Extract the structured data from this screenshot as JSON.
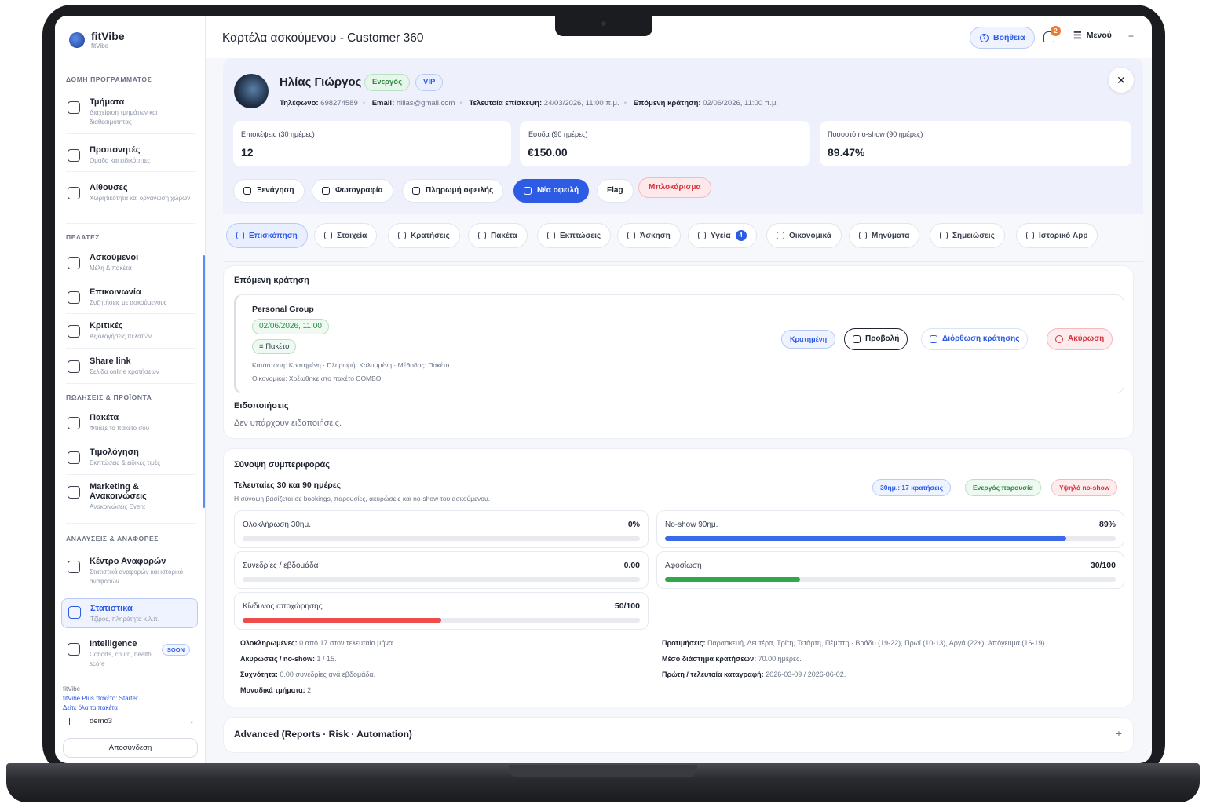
{
  "app": {
    "name": "fitVibe",
    "sub": "fitVibe"
  },
  "sidebar": {
    "sections": [
      {
        "title": "ΔΟΜΗ ΠΡΟΓΡΑΜΜΑΤΟΣ"
      },
      {
        "title": "ΠΕΛΑΤΕΣ"
      },
      {
        "title": "ΠΩΛΗΣΕΙΣ & ΠΡΟΪΟΝΤΑ"
      },
      {
        "title": "ΑΝΑΛΥΣΕΙΣ & ΑΝΑΦΟΡΕΣ"
      }
    ],
    "items": [
      {
        "label": "Τμήματα",
        "sub": "Διαχείριση τμημάτων και διαθεσιμότητας"
      },
      {
        "label": "Προπονητές",
        "sub": "Ομάδα και ειδικότητες"
      },
      {
        "label": "Αίθουσες",
        "sub": "Χωρητικότητα και οργάνωση χώρων"
      },
      {
        "label": "Ασκούμενοι",
        "sub": "Μέλη & πακέτα"
      },
      {
        "label": "Επικοινωνία",
        "sub": "Συζητήσεις με ασκούμενους"
      },
      {
        "label": "Κριτικές",
        "sub": "Αξιολογήσεις πελατών"
      },
      {
        "label": "Share link",
        "sub": "Σελίδα online κρατήσεων"
      },
      {
        "label": "Πακέτα",
        "sub": "Φτιάξε το πακέτο σου"
      },
      {
        "label": "Τιμολόγηση",
        "sub": "Εκπτώσεις & ειδικές τιμές"
      },
      {
        "label": "Marketing & Ανακοινώσεις",
        "sub": "Ανακοινώσεις Event"
      },
      {
        "label": "Κέντρο Αναφορών",
        "sub": "Στατιστικά αναφορών και ιστορικό αναφορών"
      },
      {
        "label": "Στατιστικά",
        "sub": "Τζίρος, πληρότητα κ.λ.π."
      },
      {
        "label": "Intelligence",
        "sub": "Cohorts, churn, health score",
        "badge": "SOON"
      }
    ],
    "plan": {
      "line1": "fitVibe",
      "line2": "fitVibe Plus πακέτο: Starter",
      "line3": "Δείτε όλα τα πακέτα"
    },
    "user": "demo3",
    "logout": "Αποσύνδεση"
  },
  "header": {
    "title": "Καρτέλα ασκούμενου - Customer 360",
    "help": "Βοήθεια",
    "notifications": "2",
    "menu": "Μενού"
  },
  "profile": {
    "name": "Ηλίας Γιώργος",
    "status": "Ενεργός",
    "tier": "VIP",
    "phone_label": "Τηλέφωνο:",
    "phone": "698274589",
    "email_label": "Email:",
    "email": "hilias@gmail.com",
    "last_visit_label": "Τελευταία επίσκεψη:",
    "last_visit": "24/03/2026, 11:00 π.μ.",
    "next_booking_label": "Επόμενη κράτηση:",
    "next_booking": "02/06/2026, 11:00 π.μ.",
    "stats": [
      {
        "label": "Επισκέψεις (30 ημέρες)",
        "value": "12"
      },
      {
        "label": "Έσοδα (90 ημέρες)",
        "value": "€150.00"
      },
      {
        "label": "Ποσοστό no-show (90 ημέρες)",
        "value": "89.47%"
      }
    ],
    "actions": [
      "Ξενάγηση",
      "Φωτογραφία",
      "Πληρωμή οφειλής",
      "Νέα οφειλή",
      "Flag",
      "Μπλοκάρισμα"
    ]
  },
  "tabs": [
    {
      "label": "Επισκόπηση"
    },
    {
      "label": "Στοιχεία"
    },
    {
      "label": "Κρατήσεις"
    },
    {
      "label": "Πακέτα"
    },
    {
      "label": "Εκπτώσεις"
    },
    {
      "label": "Άσκηση"
    },
    {
      "label": "Υγεία",
      "count": "4"
    },
    {
      "label": "Οικονομικά"
    },
    {
      "label": "Μηνύματα"
    },
    {
      "label": "Σημειώσεις"
    },
    {
      "label": "Ιστορικό App"
    }
  ],
  "next_booking_card": {
    "title": "Επόμενη κράτηση",
    "class_name": "Personal Group",
    "datetime": "02/06/2026, 11:00",
    "package": "Πακέτο",
    "line1": "Κατάσταση: Κρατημένη · Πληρωμή: Καλυμμένη · Μέθοδος: Πακέτο",
    "line2": "Οικονομικά: Χρέωθηκε στο πακέτο COMBO",
    "status": "Κρατημένη",
    "view": "Προβολή",
    "edit": "Διόρθωση κράτησης",
    "cancel": "Ακύρωση",
    "notifications_title": "Ειδοποιήσεις",
    "notifications_empty": "Δεν υπάρχουν ειδοποιήσεις."
  },
  "behavior": {
    "title": "Σύνοψη συμπεριφοράς",
    "subtitle": "Τελευταίες 30 και 90 ημέρες",
    "desc": "Η σύνοψη βασίζεται σε bookings, παρουσίες, ακυρώσεις και no-show του ασκούμενου.",
    "pills": [
      "30ημ.: 17 κρατήσεις",
      "Ενεργός παρουσία",
      "Υψηλό no-show"
    ],
    "metrics": [
      {
        "label": "Ολοκλήρωση 30ημ.",
        "value": "0%",
        "level": 0
      },
      {
        "label": "No-show 90ημ.",
        "value": "89%",
        "level": 0.89
      },
      {
        "label": "Συνεδρίες / εβδομάδα",
        "value": "0.00",
        "level": 0
      },
      {
        "label": "Αφοσίωση",
        "value": "30/100",
        "level": 0.3
      },
      {
        "label": "Κίνδυνος αποχώρησης",
        "value": "50/100",
        "level": 0.5
      }
    ],
    "facts_left": [
      {
        "k": "Ολοκληρωμένες:",
        "v": "0 από 17 στον τελευταίο μήνα."
      },
      {
        "k": "Ακυρώσεις / no-show:",
        "v": "1 / 15."
      },
      {
        "k": "Συχνότητα:",
        "v": "0.00 συνεδρίες ανά εβδομάδα."
      },
      {
        "k": "Μοναδικά τμήματα:",
        "v": "2."
      }
    ],
    "facts_right": [
      {
        "k": "Προτιμήσεις:",
        "v": "Παρασκευή, Δευτέρα, Τρίτη, Τετάρτη, Πέμπτη · Βράδυ (19-22), Πρωί (10-13), Αργά (22+), Απόγευμα (16-19)"
      },
      {
        "k": "Μέσο διάστημα κρατήσεων:",
        "v": "70.00 ημέρες."
      },
      {
        "k": "Πρώτη / τελευταία καταγραφή:",
        "v": "2026-03-09 / 2026-06-02."
      }
    ]
  },
  "advanced": {
    "title": "Advanced (Reports · Risk · Automation)"
  },
  "colors": {
    "accent": "#2d5be3",
    "green": "#2c8a43",
    "red": "#d6333d",
    "bar_blue": "#3b6ae8",
    "bar_green": "#2fa84a",
    "bar_red": "#ef4c4c"
  }
}
